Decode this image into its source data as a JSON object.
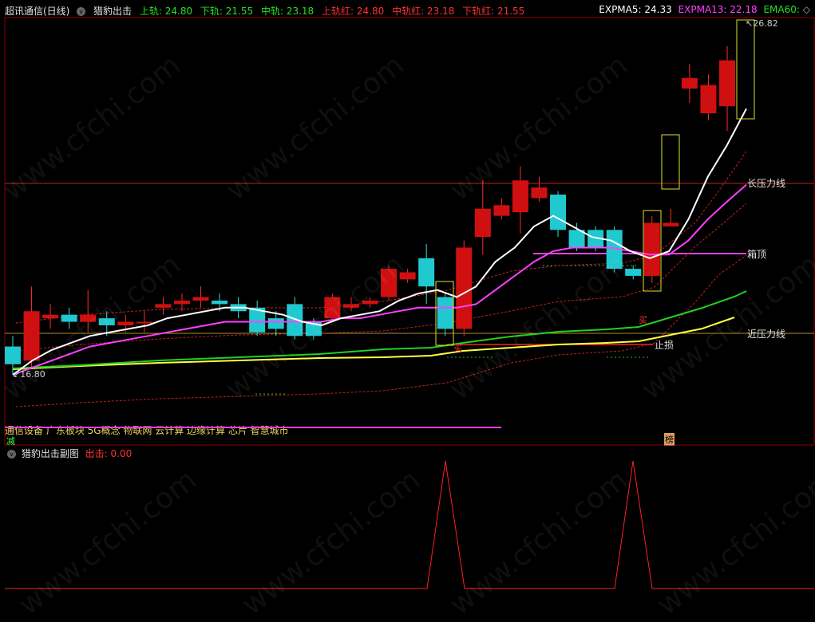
{
  "header": {
    "stock": "超讯通信(日线)",
    "indicator": "猎豹出击",
    "upper": "上轨: 24.80",
    "lower": "下轨: 21.55",
    "mid": "中轨: 23.18",
    "upper_red": "上轨红: 24.80",
    "mid_red": "中轨红: 23.18",
    "lower_red": "下轨红: 21.55",
    "expma5": "EXPMA5: 24.33",
    "expma13": "EXPMA13: 22.18",
    "ema60": "EMA60:"
  },
  "labels": {
    "high_price": "26.82",
    "low_price": "16.80",
    "long_pressure": "长压力线",
    "box_top": "箱顶",
    "near_pressure": "近压力线",
    "stop_loss": "止损",
    "buy1": "买",
    "buy2": "买",
    "concepts": "通信设备 广东板块 5G概念 物联网 云计算 边缘计算 芯片 智慧城市",
    "reduce": "减",
    "bang": "榜"
  },
  "sub": {
    "title": "猎豹出击副图",
    "output": "出击: 0.00"
  },
  "watermark": "www.cfchi.com",
  "colors": {
    "red": "#ff2a2a",
    "cyan": "#30e0e0",
    "magenta": "#ff40ff",
    "green": "#22d022",
    "yellow": "#ffff40",
    "white": "#ffffff"
  },
  "chart_data": {
    "type": "candlestick",
    "candles": [
      {
        "o": 17.6,
        "c": 17.1,
        "h": 17.9,
        "l": 16.8
      },
      {
        "o": 17.2,
        "c": 18.6,
        "h": 19.3,
        "l": 17.0
      },
      {
        "o": 18.4,
        "c": 18.5,
        "h": 18.8,
        "l": 18.1
      },
      {
        "o": 18.5,
        "c": 18.3,
        "h": 18.7,
        "l": 18.1
      },
      {
        "o": 18.3,
        "c": 18.5,
        "h": 19.2,
        "l": 18.0
      },
      {
        "o": 18.4,
        "c": 18.2,
        "h": 18.6,
        "l": 17.9
      },
      {
        "o": 18.2,
        "c": 18.3,
        "h": 18.5,
        "l": 18.0
      },
      {
        "o": 18.3,
        "c": 18.3,
        "h": 18.6,
        "l": 18.0
      },
      {
        "o": 18.7,
        "c": 18.8,
        "h": 19.0,
        "l": 18.5
      },
      {
        "o": 18.8,
        "c": 18.9,
        "h": 19.1,
        "l": 18.6
      },
      {
        "o": 18.9,
        "c": 19.0,
        "h": 19.3,
        "l": 18.7
      },
      {
        "o": 18.9,
        "c": 18.8,
        "h": 19.1,
        "l": 18.6
      },
      {
        "o": 18.8,
        "c": 18.6,
        "h": 19.0,
        "l": 18.4
      },
      {
        "o": 18.7,
        "c": 18.0,
        "h": 18.9,
        "l": 17.9
      },
      {
        "o": 18.4,
        "c": 18.1,
        "h": 18.6,
        "l": 17.9
      },
      {
        "o": 18.8,
        "c": 17.9,
        "h": 19.0,
        "l": 17.8
      },
      {
        "o": 18.3,
        "c": 17.9,
        "h": 18.4,
        "l": 17.8
      },
      {
        "o": 18.4,
        "c": 19.0,
        "h": 19.1,
        "l": 18.3
      },
      {
        "o": 18.7,
        "c": 18.8,
        "h": 19.0,
        "l": 18.6
      },
      {
        "o": 18.8,
        "c": 18.9,
        "h": 19.0,
        "l": 18.7
      },
      {
        "o": 19.0,
        "c": 19.8,
        "h": 19.9,
        "l": 18.9
      },
      {
        "o": 19.5,
        "c": 19.7,
        "h": 19.8,
        "l": 19.4
      },
      {
        "o": 20.1,
        "c": 19.3,
        "h": 20.5,
        "l": 18.8
      },
      {
        "o": 19.0,
        "c": 18.1,
        "h": 19.1,
        "l": 17.9
      },
      {
        "o": 18.1,
        "c": 20.4,
        "h": 20.6,
        "l": 17.9
      },
      {
        "o": 20.7,
        "c": 21.5,
        "h": 22.3,
        "l": 20.2
      },
      {
        "o": 21.3,
        "c": 21.6,
        "h": 21.8,
        "l": 21.2
      },
      {
        "o": 21.4,
        "c": 22.3,
        "h": 22.7,
        "l": 20.8
      },
      {
        "o": 21.8,
        "c": 22.1,
        "h": 22.4,
        "l": 21.7
      },
      {
        "o": 21.9,
        "c": 20.9,
        "h": 22.0,
        "l": 20.7
      },
      {
        "o": 20.9,
        "c": 20.4,
        "h": 21.1,
        "l": 20.3
      },
      {
        "o": 20.9,
        "c": 20.4,
        "h": 21.0,
        "l": 20.3
      },
      {
        "o": 20.9,
        "c": 19.8,
        "h": 21.0,
        "l": 19.7
      },
      {
        "o": 19.8,
        "c": 19.6,
        "h": 19.9,
        "l": 19.5
      },
      {
        "o": 19.6,
        "c": 21.1,
        "h": 21.3,
        "l": 19.4
      },
      {
        "o": 21.0,
        "c": 21.1,
        "h": 21.5,
        "l": 21.0
      },
      {
        "o": 24.9,
        "c": 25.2,
        "h": 25.6,
        "l": 24.5
      },
      {
        "o": 24.2,
        "c": 25.0,
        "h": 25.3,
        "l": 24.0
      },
      {
        "o": 24.4,
        "c": 25.7,
        "h": 26.1,
        "l": 23.7
      }
    ],
    "expma5": [
      16.8,
      17.2,
      17.5,
      17.7,
      17.9,
      18.0,
      18.1,
      18.2,
      18.4,
      18.5,
      18.6,
      18.7,
      18.7,
      18.6,
      18.5,
      18.3,
      18.2,
      18.4,
      18.5,
      18.6,
      18.9,
      19.1,
      19.2,
      19.0,
      19.3,
      20.0,
      20.4,
      21.0,
      21.3,
      21.0,
      20.7,
      20.6,
      20.3,
      20.1,
      20.3,
      21.2,
      22.4,
      23.3,
      24.33
    ],
    "expma13": [
      16.8,
      17.0,
      17.2,
      17.4,
      17.6,
      17.7,
      17.8,
      17.9,
      18.0,
      18.1,
      18.2,
      18.3,
      18.3,
      18.3,
      18.3,
      18.3,
      18.3,
      18.4,
      18.4,
      18.5,
      18.6,
      18.7,
      18.7,
      18.7,
      18.8,
      19.2,
      19.6,
      20.0,
      20.3,
      20.4,
      20.4,
      20.4,
      20.3,
      20.2,
      20.2,
      20.6,
      21.2,
      21.7,
      22.18
    ]
  }
}
